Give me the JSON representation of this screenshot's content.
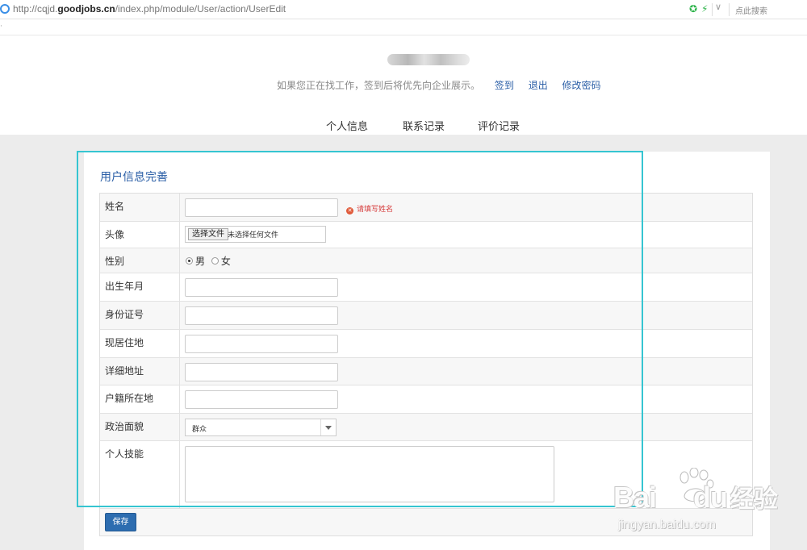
{
  "browser": {
    "url_prefix": "http://cqjd.",
    "url_domain": "goodjobs.cn",
    "url_path": "/index.php/module/User/action/UserEdit",
    "search_hint": "点此搜索"
  },
  "header": {
    "hint": "如果您正在找工作，签到后将优先向企业展示。",
    "links": [
      "签到",
      "退出",
      "修改密码"
    ]
  },
  "nav": {
    "tabs": [
      "个人信息",
      "联系记录",
      "评价记录"
    ]
  },
  "form": {
    "title": "用户信息完善",
    "fields": {
      "name": {
        "label": "姓名",
        "value": "",
        "error": "请填写姓名"
      },
      "avatar": {
        "label": "头像",
        "button": "选择文件",
        "status": "未选择任何文件"
      },
      "gender": {
        "label": "性别",
        "options": [
          "男",
          "女"
        ],
        "selected": "男"
      },
      "birth": {
        "label": "出生年月",
        "value": ""
      },
      "id_number": {
        "label": "身份证号",
        "value": ""
      },
      "residence": {
        "label": "现居住地",
        "value": ""
      },
      "address": {
        "label": "详细地址",
        "value": ""
      },
      "hukou": {
        "label": "户籍所在地",
        "value": ""
      },
      "political": {
        "label": "政治面貌",
        "value": "群众"
      },
      "skills": {
        "label": "个人技能",
        "value": ""
      }
    },
    "save_label": "保存"
  },
  "watermark": {
    "main": "Bai",
    "main2": "du",
    "cn": "经验",
    "sub": "jingyan.baidu.com"
  },
  "colors": {
    "link": "#2a5ea6",
    "button": "#2d6db0",
    "highlight": "#36c5d1",
    "error": "#d63a3a"
  }
}
